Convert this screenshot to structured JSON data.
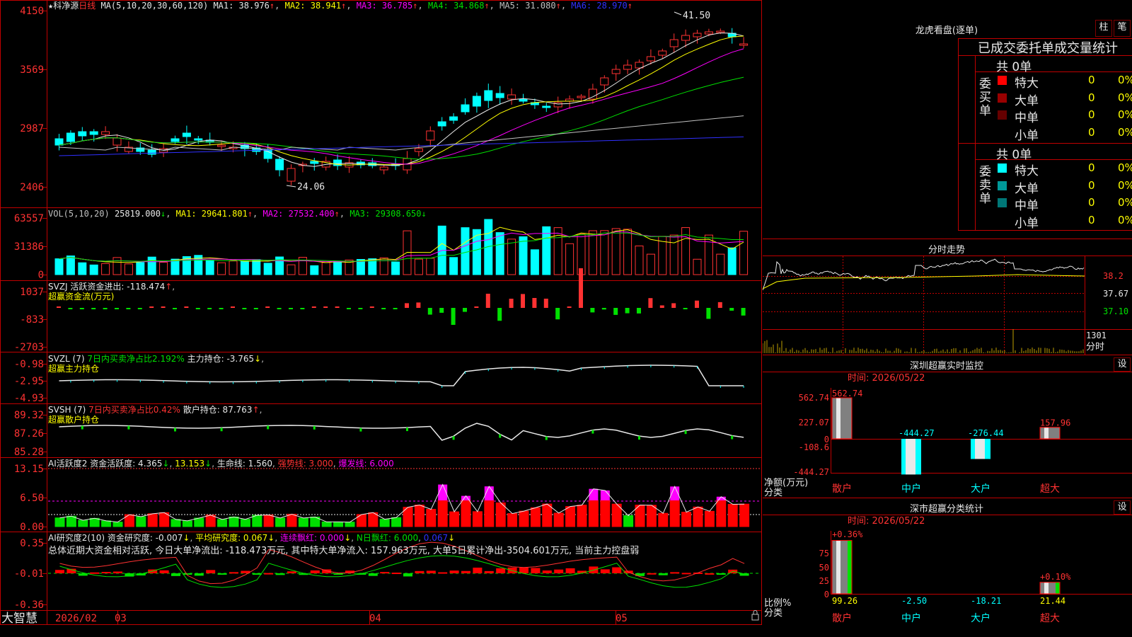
{
  "app": {
    "brand": "大智慧"
  },
  "header": {
    "stock_name": "★科净源",
    "period": "日线",
    "ma_def": "MA(5,10,20,30,60,120)",
    "ma1": "MA1: 38.976",
    "ma2": "MA2: 38.941",
    "ma3": "MA3: 36.785",
    "ma4": "MA4: 34.868",
    "ma5": "MA5: 31.080",
    "ma6": "MA6: 28.970",
    "high_mark": "41.50",
    "low_mark": "24.06"
  },
  "axes": {
    "price": [
      "4150",
      "3569",
      "2987",
      "2406"
    ],
    "vol": [
      "63557",
      "31386",
      "0"
    ],
    "svzj": [
      "1037",
      "-833",
      "-2703"
    ],
    "svzl": [
      "-0.98",
      "-2.95",
      "-4.93"
    ],
    "svsh": [
      "89.32",
      "87.26",
      "85.28"
    ],
    "ai1": [
      "13.15",
      "6.50",
      "0.00"
    ],
    "ai2": [
      "0.35",
      "-0.01",
      "-0.36"
    ],
    "dates": [
      "2026/02",
      "03",
      "04",
      "05"
    ]
  },
  "panes": {
    "vol": {
      "def": "VOL(5,10,20)",
      "v": "25819.000",
      "ma1": "MA1: 29641.801",
      "ma2": "MA2: 27532.400",
      "ma3": "MA3: 29308.650"
    },
    "svzj": {
      "t1": "SVZJ  活跃资金进出: -118.474",
      "t2": "超赢资金流(万元)"
    },
    "svzl": {
      "t1": "SVZL (7)",
      "t2": "7日内买卖净占比2.192%",
      "t3": "主力持仓: -3.765",
      "t4": "超赢主力持仓"
    },
    "svsh": {
      "t1": "SVSH (7)",
      "t2": "7日内买卖净占比0.42%",
      "t3": "散户持仓: 87.763",
      "t4": "超赢散户持仓"
    },
    "ai1": {
      "t1": "AI活跃度2 资金活跃度: 4.365",
      "t2": "13.153",
      "t3": "生命线: 1.560",
      "t4": "强势线: 3.000",
      "t5": "爆发线: 6.000"
    },
    "ai2": {
      "t1": "AI研究度2(10) 资金研究度: -0.007",
      "t2": "平均研究度: 0.067",
      "t3": "连续飘红: 0.000",
      "t4": "N日飘红: 6.000",
      "t5": "0.067"
    },
    "summary": "总体近期大资金相对活跃, 今日大单净流出: -118.473万元, 其中特大单净流入: 157.963万元, 大单5日累计净出-3504.601万元, 当前主力控盘弱"
  },
  "right": {
    "lhb_title": "龙虎看盘(逐单)",
    "btn1": "柱",
    "btn2": "笔",
    "table_title": "已成交委托单成交量统计",
    "buy_label": "委买单",
    "sell_label": "委卖单",
    "buy_total": "共 0单",
    "sell_total": "共 0单",
    "buy_rows": [
      {
        "name": "特大",
        "count": "0",
        "pct": "0%",
        "color": "#ff0000"
      },
      {
        "name": "大单",
        "count": "0",
        "pct": "0%",
        "color": "#990000"
      },
      {
        "name": "中单",
        "count": "0",
        "pct": "0%",
        "color": "#660000"
      },
      {
        "name": "小单",
        "count": "0",
        "pct": "0%",
        "color": ""
      }
    ],
    "sell_rows": [
      {
        "name": "特大",
        "count": "0",
        "pct": "0%",
        "color": "#00ffff"
      },
      {
        "name": "大单",
        "count": "0",
        "pct": "0%",
        "color": "#009999"
      },
      {
        "name": "中单",
        "count": "0",
        "pct": "0%",
        "color": "#007777"
      },
      {
        "name": "小单",
        "count": "0",
        "pct": "0%",
        "color": ""
      }
    ],
    "fs_title": "分时走势",
    "fs_prices": [
      "38.2",
      "37.67",
      "37.10"
    ],
    "fs_vol": "1301",
    "fs_vol_lbl": "分时",
    "sz_title": "深圳超赢实时监控",
    "sz_btn": "设",
    "sz_time": "时间: 2026/05/22",
    "sz_axis": [
      "562.74",
      "227.07",
      "0",
      "-108.6",
      "-444.27"
    ],
    "sz_unit": "净额(万元)",
    "sz_cat": "分类",
    "sz_vals": [
      "562.74",
      "-444.27",
      "-276.44",
      "157.96"
    ],
    "cats": [
      "散户",
      "中户",
      "大户",
      "超大"
    ],
    "sh_title": "深市超赢分类统计",
    "sh_btn": "设",
    "sh_time": "时间: 2026/05/22",
    "sh_axis": [
      "75",
      "50",
      "25",
      "0"
    ],
    "sh_unit": "比例%",
    "sh_cat": "分类",
    "sh_top": [
      "+0.36%",
      "+0.10%"
    ],
    "sh_vals": [
      "99.26",
      "-2.50",
      "-18.21",
      "21.44"
    ]
  }
}
